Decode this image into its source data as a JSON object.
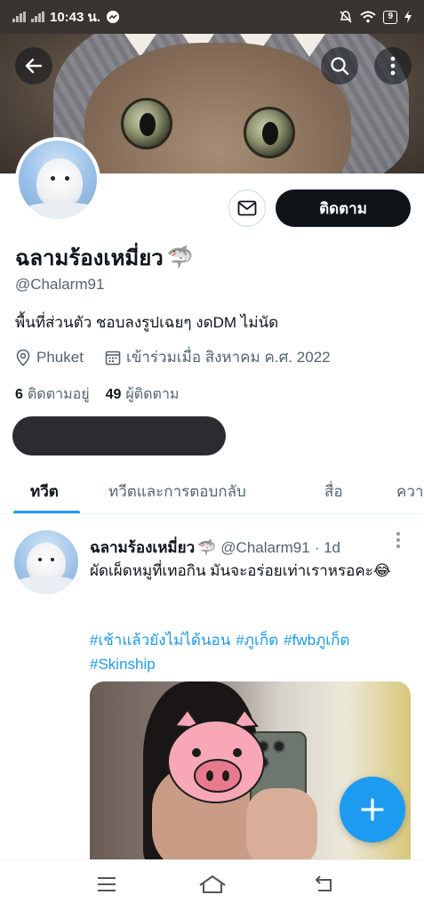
{
  "status_bar": {
    "time": "10:43 น.",
    "battery": "9"
  },
  "profile": {
    "display_name": "ฉลามร้องเหมี่ยว",
    "name_emoji": "🦈",
    "handle": "@Chalarm91",
    "bio": "พื้นที่ส่วนตัว ชอบลงรูปเฉยๆ งดDM ไม่นัด",
    "location": "Phuket",
    "joined": "เข้าร่วมเมื่อ สิงหาคม ค.ศ. 2022",
    "following_count": "6",
    "following_label": "ติดตามอยู่",
    "followers_count": "49",
    "followers_label": "ผู้ติดตาม",
    "follow_button": "ติดตาม"
  },
  "tabs": [
    {
      "label": "ทวีต",
      "active": true
    },
    {
      "label": "ทวีตและการตอบกลับ",
      "active": false
    },
    {
      "label": "สื่อ",
      "active": false
    },
    {
      "label": "ควา",
      "active": false
    }
  ],
  "tweet": {
    "display_name": "ฉลามร้องเหมี่ยว",
    "emoji": "🦈",
    "handle": "@Chalarm91",
    "time": "· 1d",
    "text": "ผัดเผ็ดหมูที่เทอกิน มันจะอร่อยเท่าเราหรอคะ😂",
    "hashtags": [
      "#เช้าแล้วยังไม่ได้นอน",
      "#ภูเก็ต",
      "#fwbภูเก็ต",
      "#Skinship"
    ]
  },
  "colors": {
    "accent": "#1d9bf0",
    "text": "#0f1419",
    "muted": "#536471"
  },
  "icons": [
    "back-arrow-icon",
    "search-icon",
    "more-vertical-icon",
    "mail-icon",
    "location-pin-icon",
    "calendar-icon",
    "compose-plus-icon",
    "menu-icon",
    "home-icon",
    "back-nav-icon"
  ]
}
